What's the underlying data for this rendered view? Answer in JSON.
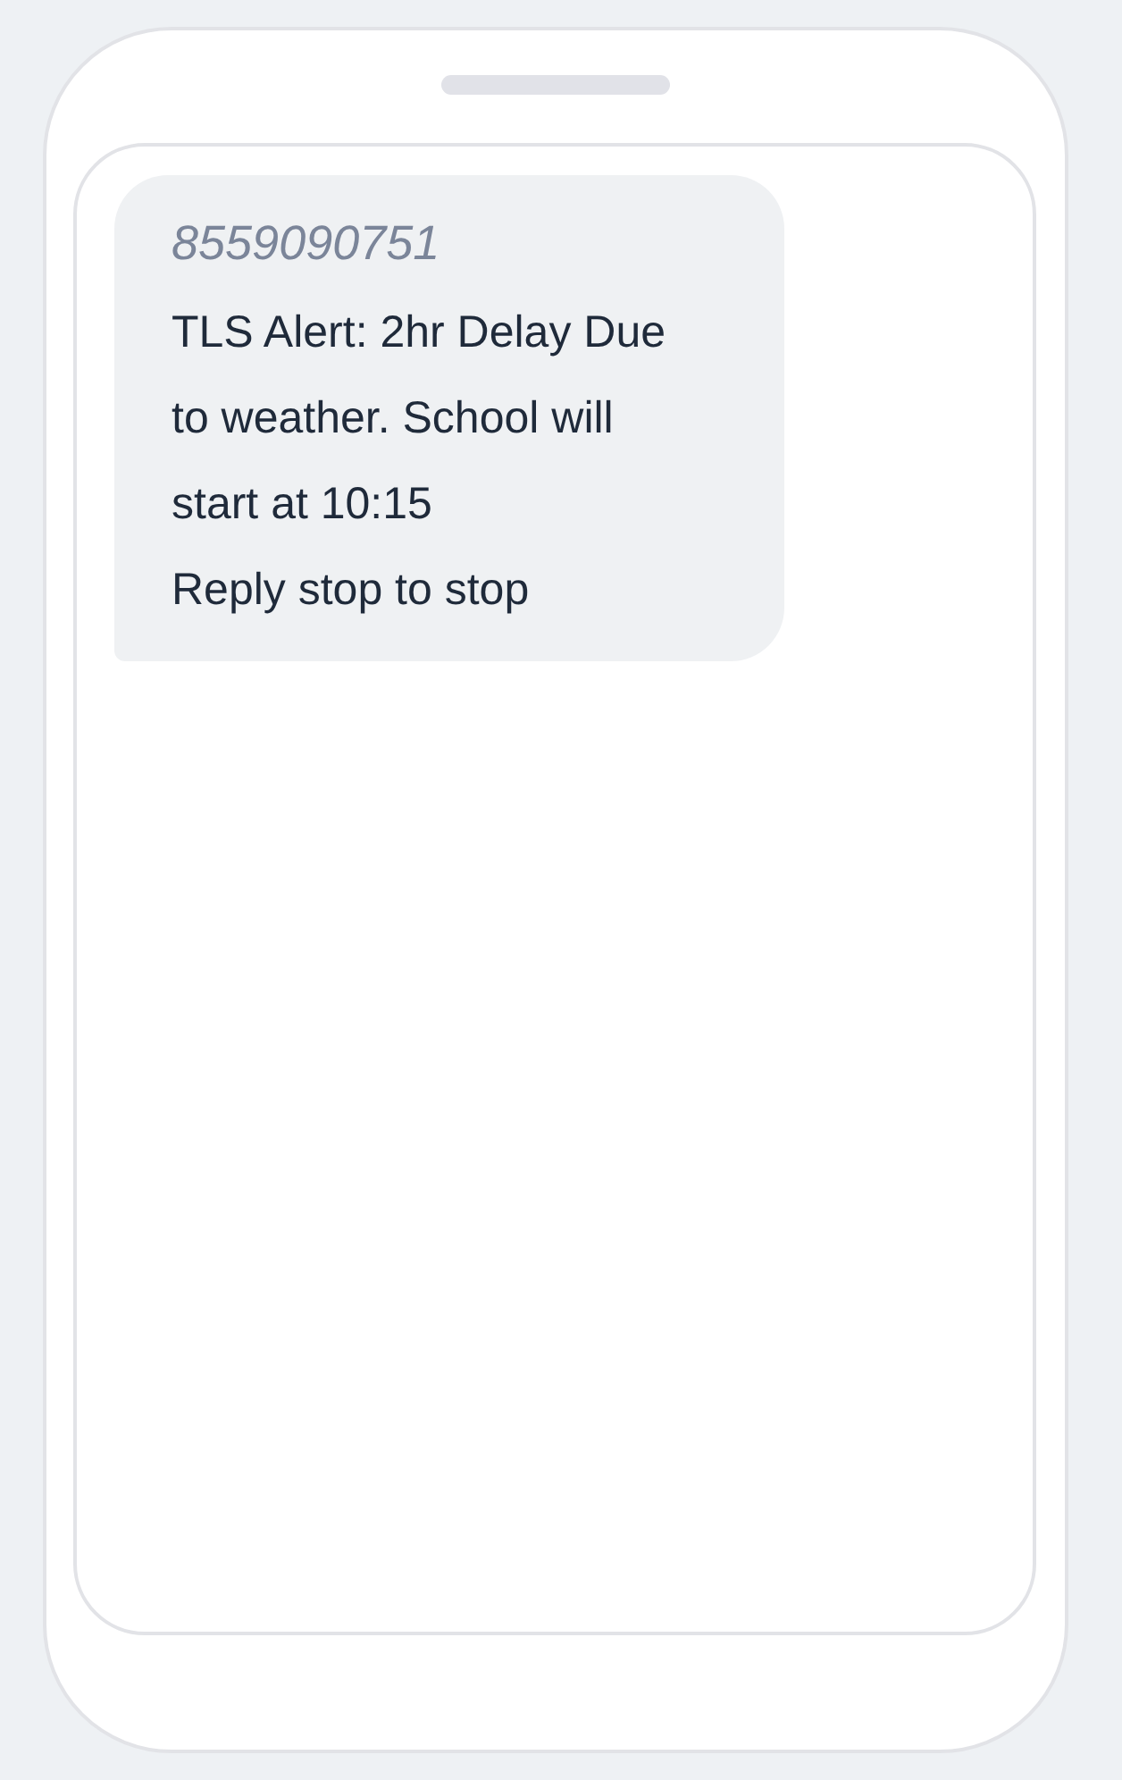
{
  "messages": [
    {
      "kind": "incoming",
      "sender": "8559090751",
      "text": "TLS Alert: 2hr Delay Due to weather. School will start at 10:15\nReply stop to stop"
    }
  ]
}
